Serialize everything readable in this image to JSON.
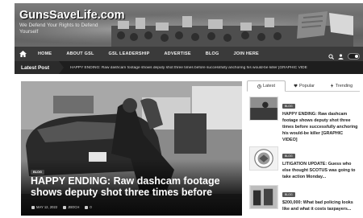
{
  "site": {
    "title": "GunsSaveLife.com",
    "tagline": "We Defend Your Rights to Defend Yourself"
  },
  "nav": {
    "items": [
      "HOME",
      "ABOUT GSL",
      "GSL LEADERSHIP",
      "ADVERTISE",
      "BLOG",
      "JOIN HERE"
    ]
  },
  "ticker": {
    "label": "Latest Post",
    "text": "HAPPY ENDING: Raw dashcam footage shows deputy shot three times before successfully anchoring his would-be killer [GRAPHIC VIDE"
  },
  "feature": {
    "badge": "BLOG",
    "title": "HAPPY ENDING: Raw dashcam footage shows deputy shot three times before",
    "date": "MAY 12, 2022",
    "author": "JBOCH",
    "extra": "0"
  },
  "sidebar": {
    "tabs": [
      "Latest",
      "Popular",
      "Trending"
    ],
    "posts": [
      {
        "badge": "BLOG",
        "title": "HAPPY ENDING: Raw dashcam footage shows deputy shot three times before successfully anchoring his would-be killer [GRAPHIC VIDEO]"
      },
      {
        "badge": "BLOG",
        "title": "LITIGATION UPDATE: Guess who else thought SCOTUS was going to take action Monday..."
      },
      {
        "badge": "BLOG",
        "title": "$200,000: What bad policing looks like and what it costs taxpayers..."
      }
    ]
  },
  "colors": {
    "nav_bg": "#3a3a3a",
    "ticker_bg": "#1e1e1e"
  }
}
